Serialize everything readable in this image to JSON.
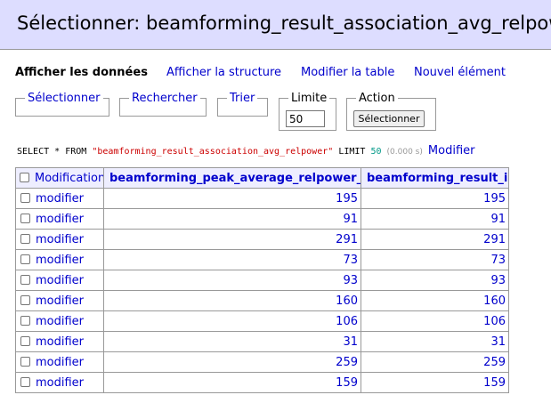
{
  "page": {
    "title": "Sélectionner: beamforming_result_association_avg_relpower"
  },
  "nav_links": [
    {
      "label": "Afficher les données",
      "active": true
    },
    {
      "label": "Afficher la structure",
      "active": false
    },
    {
      "label": "Modifier la table",
      "active": false
    },
    {
      "label": "Nouvel élément",
      "active": false
    }
  ],
  "toolbar": {
    "select_label": "Sélectionner",
    "search_label": "Rechercher",
    "sort_label": "Trier",
    "limit_label": "Limite",
    "limit_value": "50",
    "action_label": "Action",
    "action_button": "Sélectionner"
  },
  "query": {
    "select_kw": "SELECT",
    "star": "*",
    "from_kw": "FROM",
    "table": "\"beamforming_result_association_avg_relpower\"",
    "limit_kw": "LIMIT",
    "limit_num": "50",
    "time": "(0.000 s)",
    "edit_link": "Modifier"
  },
  "table": {
    "columns": [
      "Modification",
      "beamforming_peak_average_relpower_id",
      "beamforming_result_id"
    ],
    "row_action": "modifier",
    "rows": [
      [
        "195",
        "195"
      ],
      [
        "91",
        "91"
      ],
      [
        "291",
        "291"
      ],
      [
        "73",
        "73"
      ],
      [
        "93",
        "93"
      ],
      [
        "160",
        "160"
      ],
      [
        "106",
        "106"
      ],
      [
        "31",
        "31"
      ],
      [
        "259",
        "259"
      ],
      [
        "159",
        "159"
      ]
    ]
  },
  "colors": {
    "header_bg": "#ddf",
    "link": "#00c",
    "table_header_bg": "#eef"
  }
}
